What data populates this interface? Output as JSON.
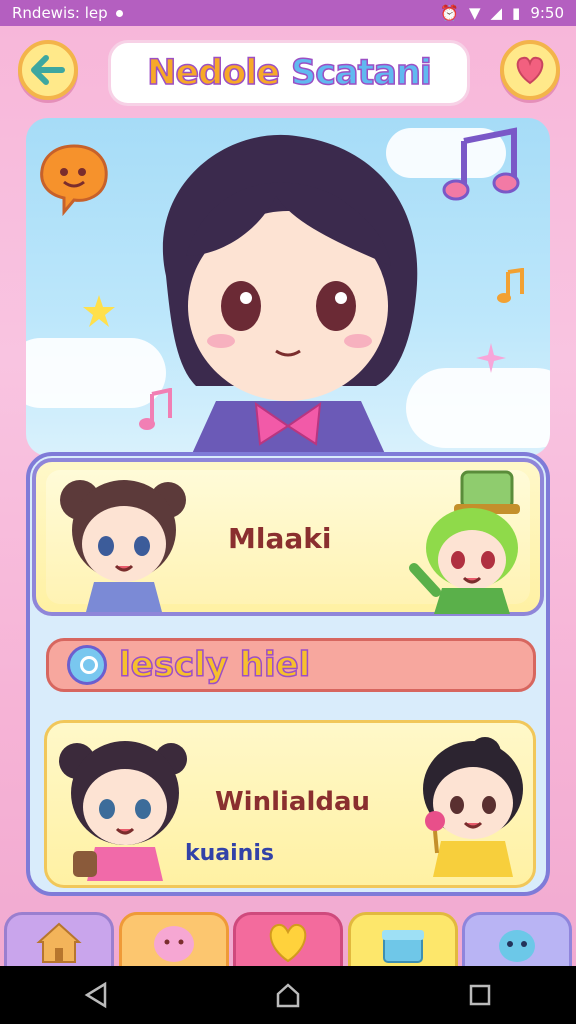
{
  "status_bar": {
    "app_name": "Rndewis: lep",
    "time": "9:50",
    "icons": [
      "notification-dot-icon",
      "alarm-icon",
      "wifi-icon",
      "signal-icon",
      "battery-icon"
    ]
  },
  "header": {
    "title_word1": "Nedole",
    "title_word2": "Scatani",
    "back_icon": "arrow-left-icon",
    "favorite_icon": "heart-icon"
  },
  "hero": {
    "decor_icons": [
      "chat-bubble-icon",
      "music-note-icon",
      "star-icon",
      "sparkle-icon"
    ]
  },
  "cards": [
    {
      "label": "Mlaaki"
    },
    {
      "label": "Winlialdau",
      "sub": "kuainis"
    }
  ],
  "search": {
    "text": "lescly hiel",
    "icon": "search-icon"
  },
  "bottom_nav": {
    "tabs": [
      "home-icon",
      "face-icon",
      "heart-icon",
      "gift-box-icon",
      "pet-icon"
    ]
  },
  "colors": {
    "status_bar": "#b45fc0",
    "accent_yellow": "#ffe98a",
    "panel_border": "#7f7bd8",
    "search_bg": "#f7a79e"
  }
}
